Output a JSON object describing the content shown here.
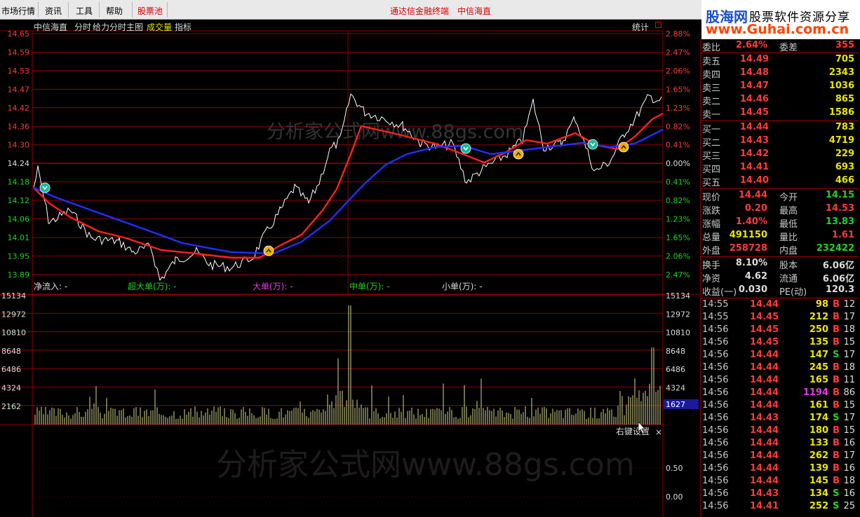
{
  "menubar": {
    "items": [
      "市场行情",
      "资讯",
      "工具",
      "帮助",
      "股票池"
    ],
    "center_items": [
      "通达信金融终端",
      "中信海直"
    ]
  },
  "logo": {
    "name": "股海网",
    "slogan": "股票软件资源分享",
    "url": "www.Guhai.com.cn"
  },
  "chart_header": {
    "stock": "中信海直",
    "tabs": [
      "分时",
      "给力分时主图",
      "成交量",
      "指标"
    ],
    "stats": "统计"
  },
  "colors": {
    "up": "#ff3b3b",
    "down": "#1fd41f",
    "grid": "#8c0000",
    "price_line": "#ffffff",
    "avg_line_blue": "#2030ff",
    "avg_line_red": "#ff2020",
    "volume": "#d8d890"
  },
  "price_axis": {
    "left": [
      "14.65",
      "14.59",
      "14.53",
      "14.47",
      "14.42",
      "14.36",
      "14.30",
      "14.24",
      "14.18",
      "14.12",
      "14.06",
      "14.01",
      "13.95",
      "13.89"
    ],
    "right": [
      "2.88%",
      "2.47%",
      "2.06%",
      "1.65%",
      "1.23%",
      "0.82%",
      "0.41%",
      "0.00%",
      "0.41%",
      "0.82%",
      "1.23%",
      "1.65%",
      "2.06%",
      "2.47%"
    ]
  },
  "flow_labels": {
    "net": "净流入: -",
    "super": "超大单(万): -",
    "big": "大单(万): -",
    "mid": "中单(万): -",
    "small": "小单(万): -"
  },
  "volume_axis": {
    "left": [
      "15134",
      "12972",
      "10810",
      "8648",
      "6486",
      "4324",
      "2162"
    ],
    "right": [
      "15134",
      "12972",
      "10810",
      "8648",
      "6486",
      "4324"
    ],
    "cursor_value": "1627"
  },
  "indicator": {
    "right_click": "右键设置",
    "close_glyph": "×",
    "ticks": [
      "0.50",
      "0.00"
    ]
  },
  "watermark": "分析家公式网www.88gs.com",
  "order_book": {
    "ratio": {
      "label": "委比",
      "value": "2.64%",
      "label2": "委差",
      "value2": "355"
    },
    "asks": [
      {
        "label": "卖五",
        "price": "14.49",
        "vol": "705"
      },
      {
        "label": "卖四",
        "price": "14.48",
        "vol": "2343"
      },
      {
        "label": "卖三",
        "price": "14.47",
        "vol": "1036"
      },
      {
        "label": "卖二",
        "price": "14.46",
        "vol": "865"
      },
      {
        "label": "卖一",
        "price": "14.45",
        "vol": "1586"
      }
    ],
    "bids": [
      {
        "label": "买一",
        "price": "14.44",
        "vol": "783"
      },
      {
        "label": "买二",
        "price": "14.43",
        "vol": "4719"
      },
      {
        "label": "买三",
        "price": "14.42",
        "vol": "229"
      },
      {
        "label": "买四",
        "price": "14.41",
        "vol": "693"
      },
      {
        "label": "买五",
        "price": "14.40",
        "vol": "466"
      }
    ]
  },
  "quote": [
    {
      "l": "现价",
      "v": "14.44",
      "vc": "up",
      "l2": "今开",
      "v2": "14.15",
      "v2c": "dn"
    },
    {
      "l": "涨跌",
      "v": "0.20",
      "vc": "up",
      "l2": "最高",
      "v2": "14.53",
      "v2c": "up"
    },
    {
      "l": "涨幅",
      "v": "1.40%",
      "vc": "up",
      "l2": "最低",
      "v2": "13.83",
      "v2c": "dn"
    },
    {
      "l": "总量",
      "v": "491150",
      "vc": "yl",
      "l2": "量比",
      "v2": "1.61",
      "v2c": "up"
    },
    {
      "l": "外盘",
      "v": "258728",
      "vc": "up",
      "l2": "内盘",
      "v2": "232422",
      "v2c": "dn"
    }
  ],
  "fundamentals": [
    {
      "l": "换手",
      "v": "8.10%",
      "l2": "股本",
      "v2": "6.06亿"
    },
    {
      "l": "净资",
      "v": "4.62",
      "l2": "流通",
      "v2": "6.06亿"
    },
    {
      "l": "收益(一)",
      "v": "0.030",
      "l2": "PE(动)",
      "v2": "120.3"
    }
  ],
  "ticks": [
    {
      "t": "14:55",
      "p": "14.44",
      "v": "98",
      "bs": "B",
      "n": "12"
    },
    {
      "t": "14:55",
      "p": "14.45",
      "v": "212",
      "bs": "B",
      "n": "17"
    },
    {
      "t": "14:56",
      "p": "14.45",
      "v": "250",
      "bs": "B",
      "n": "18"
    },
    {
      "t": "14:56",
      "p": "14.45",
      "v": "135",
      "bs": "B",
      "n": "15"
    },
    {
      "t": "14:56",
      "p": "14.44",
      "v": "147",
      "bs": "S",
      "n": "17"
    },
    {
      "t": "14:56",
      "p": "14.44",
      "v": "245",
      "bs": "B",
      "n": "18"
    },
    {
      "t": "14:56",
      "p": "14.44",
      "v": "165",
      "bs": "B",
      "n": "11"
    },
    {
      "t": "14:56",
      "p": "14.44",
      "v": "1194",
      "bs": "B",
      "n": "86"
    },
    {
      "t": "14:56",
      "p": "14.44",
      "v": "161",
      "bs": "B",
      "n": "15"
    },
    {
      "t": "14:56",
      "p": "14.43",
      "v": "174",
      "bs": "S",
      "n": "17"
    },
    {
      "t": "14:56",
      "p": "14.44",
      "v": "180",
      "bs": "B",
      "n": "15"
    },
    {
      "t": "14:56",
      "p": "14.44",
      "v": "133",
      "bs": "B",
      "n": "16"
    },
    {
      "t": "14:56",
      "p": "14.44",
      "v": "262",
      "bs": "B",
      "n": "17"
    },
    {
      "t": "14:56",
      "p": "14.44",
      "v": "139",
      "bs": "B",
      "n": "16"
    },
    {
      "t": "14:56",
      "p": "14.44",
      "v": "145",
      "bs": "B",
      "n": "18"
    },
    {
      "t": "14:56",
      "p": "14.43",
      "v": "134",
      "bs": "S",
      "n": "16"
    },
    {
      "t": "14:56",
      "p": "14.41",
      "v": "252",
      "bs": "S",
      "n": "25"
    }
  ]
}
